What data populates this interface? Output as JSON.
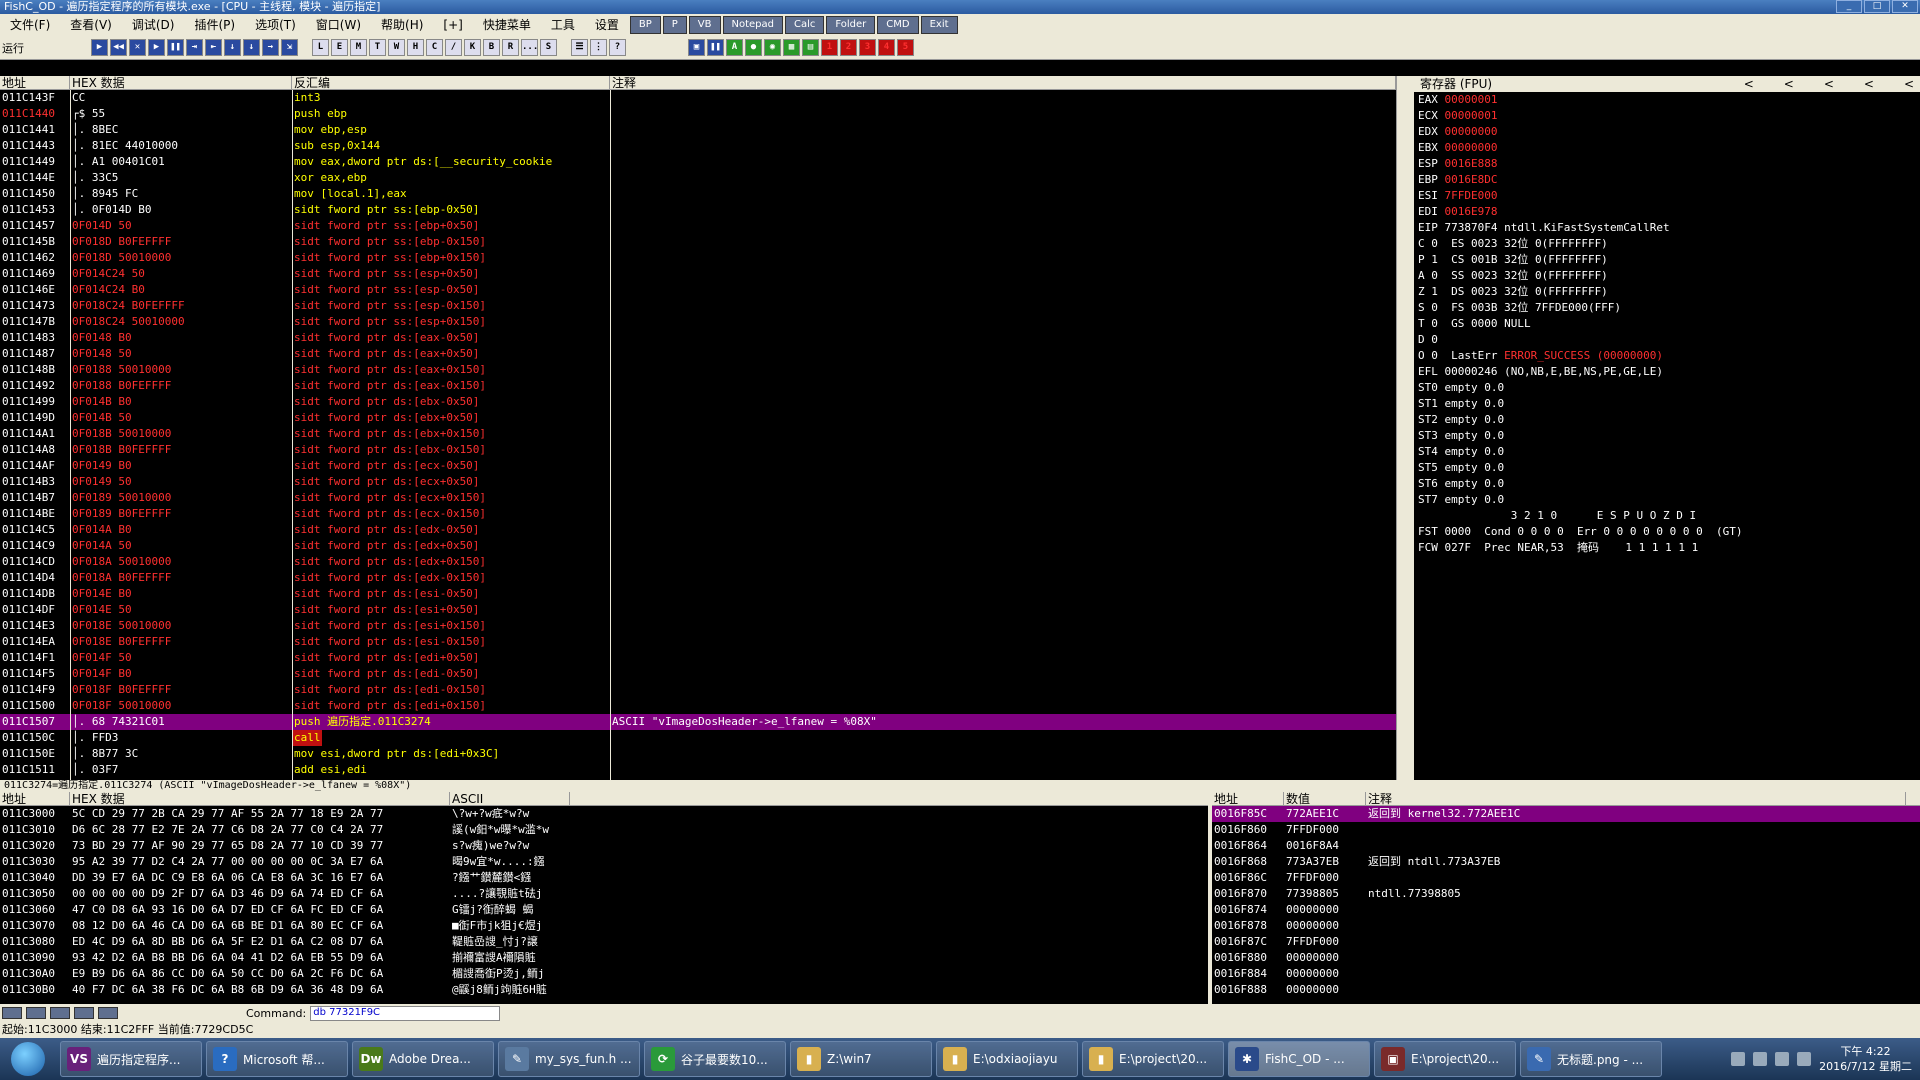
{
  "window": {
    "title": "FishC_OD - 遍历指定程序的所有模块.exe - [CPU - 主线程, 模块 - 遍历指定]"
  },
  "menu": {
    "items": [
      "文件(F)",
      "查看(V)",
      "调试(D)",
      "插件(P)",
      "选项(T)",
      "窗口(W)",
      "帮助(H)",
      "[+]",
      "快捷菜单",
      "工具",
      "设置"
    ],
    "quick": [
      "BP",
      "P",
      "VB",
      "Notepad",
      "Calc",
      "Folder",
      "CMD",
      "Exit"
    ]
  },
  "toolbar": {
    "state": "运行",
    "buttons": [
      "▶",
      "◀◀",
      "✕",
      "▶",
      "❚❚",
      "⇥",
      "⇤",
      "↓",
      "↓",
      "→",
      "⇲",
      "L",
      "E",
      "M",
      "T",
      "W",
      "H",
      "C",
      "/",
      "K",
      "B",
      "R",
      "...",
      "S",
      "☰",
      "⋮",
      "?"
    ],
    "right": [
      "▣",
      "❚❚",
      "A",
      "●",
      "◉",
      "▦",
      "▤",
      "1",
      "2",
      "3",
      "4",
      "5"
    ]
  },
  "cpu": {
    "headers": [
      "地址",
      "HEX 数据",
      "反汇编",
      "注释"
    ],
    "rows": [
      {
        "a": "011C143F",
        "h": "CC",
        "d": "int3",
        "c": "",
        "s": "n"
      },
      {
        "a": "011C1440",
        "h": "┌$ 55",
        "d": "push ebp",
        "c": "",
        "s": "ar"
      },
      {
        "a": "011C1441",
        "h": "│. 8BEC",
        "d": "mov ebp,esp",
        "c": "",
        "s": "n"
      },
      {
        "a": "011C1443",
        "h": "│. 81EC 44010000",
        "d": "sub esp,0x144",
        "c": "",
        "s": "n"
      },
      {
        "a": "011C1449",
        "h": "│. A1 00401C01",
        "d": "mov eax,dword ptr ds:[__security_cookie",
        "c": "",
        "s": "n"
      },
      {
        "a": "011C144E",
        "h": "│. 33C5",
        "d": "xor eax,ebp",
        "c": "",
        "s": "n"
      },
      {
        "a": "011C1450",
        "h": "│. 8945 FC",
        "d": "mov [local.1],eax",
        "c": "",
        "s": "n"
      },
      {
        "a": "011C1453",
        "h": "│. 0F014D B0",
        "d": "sidt fword ptr ss:[ebp-0x50]",
        "c": "",
        "s": "n"
      },
      {
        "a": "011C1457",
        "h": "  0F014D 50",
        "d": "sidt fword ptr ss:[ebp+0x50]",
        "c": "",
        "s": "r"
      },
      {
        "a": "011C145B",
        "h": "  0F018D B0FEFFFF",
        "d": "sidt fword ptr ss:[ebp-0x150]",
        "c": "",
        "s": "r"
      },
      {
        "a": "011C1462",
        "h": "  0F018D 50010000",
        "d": "sidt fword ptr ss:[ebp+0x150]",
        "c": "",
        "s": "r"
      },
      {
        "a": "011C1469",
        "h": "  0F014C24 50",
        "d": "sidt fword ptr ss:[esp+0x50]",
        "c": "",
        "s": "r"
      },
      {
        "a": "011C146E",
        "h": "  0F014C24 B0",
        "d": "sidt fword ptr ss:[esp-0x50]",
        "c": "",
        "s": "r"
      },
      {
        "a": "011C1473",
        "h": "  0F018C24 B0FEFFFF",
        "d": "sidt fword ptr ss:[esp-0x150]",
        "c": "",
        "s": "r"
      },
      {
        "a": "011C147B",
        "h": "  0F018C24 50010000",
        "d": "sidt fword ptr ss:[esp+0x150]",
        "c": "",
        "s": "r"
      },
      {
        "a": "011C1483",
        "h": "  0F0148 B0",
        "d": "sidt fword ptr ds:[eax-0x50]",
        "c": "",
        "s": "r"
      },
      {
        "a": "011C1487",
        "h": "  0F0148 50",
        "d": "sidt fword ptr ds:[eax+0x50]",
        "c": "",
        "s": "r"
      },
      {
        "a": "011C148B",
        "h": "  0F0188 50010000",
        "d": "sidt fword ptr ds:[eax+0x150]",
        "c": "",
        "s": "r"
      },
      {
        "a": "011C1492",
        "h": "  0F0188 B0FEFFFF",
        "d": "sidt fword ptr ds:[eax-0x150]",
        "c": "",
        "s": "r"
      },
      {
        "a": "011C1499",
        "h": "  0F014B B0",
        "d": "sidt fword ptr ds:[ebx-0x50]",
        "c": "",
        "s": "r"
      },
      {
        "a": "011C149D",
        "h": "  0F014B 50",
        "d": "sidt fword ptr ds:[ebx+0x50]",
        "c": "",
        "s": "r"
      },
      {
        "a": "011C14A1",
        "h": "  0F018B 50010000",
        "d": "sidt fword ptr ds:[ebx+0x150]",
        "c": "",
        "s": "r"
      },
      {
        "a": "011C14A8",
        "h": "  0F018B B0FEFFFF",
        "d": "sidt fword ptr ds:[ebx-0x150]",
        "c": "",
        "s": "r"
      },
      {
        "a": "011C14AF",
        "h": "  0F0149 B0",
        "d": "sidt fword ptr ds:[ecx-0x50]",
        "c": "",
        "s": "r"
      },
      {
        "a": "011C14B3",
        "h": "  0F0149 50",
        "d": "sidt fword ptr ds:[ecx+0x50]",
        "c": "",
        "s": "r"
      },
      {
        "a": "011C14B7",
        "h": "  0F0189 50010000",
        "d": "sidt fword ptr ds:[ecx+0x150]",
        "c": "",
        "s": "r"
      },
      {
        "a": "011C14BE",
        "h": "  0F0189 B0FEFFFF",
        "d": "sidt fword ptr ds:[ecx-0x150]",
        "c": "",
        "s": "r"
      },
      {
        "a": "011C14C5",
        "h": "  0F014A B0",
        "d": "sidt fword ptr ds:[edx-0x50]",
        "c": "",
        "s": "r"
      },
      {
        "a": "011C14C9",
        "h": "  0F014A 50",
        "d": "sidt fword ptr ds:[edx+0x50]",
        "c": "",
        "s": "r"
      },
      {
        "a": "011C14CD",
        "h": "  0F018A 50010000",
        "d": "sidt fword ptr ds:[edx+0x150]",
        "c": "",
        "s": "r"
      },
      {
        "a": "011C14D4",
        "h": "  0F018A B0FEFFFF",
        "d": "sidt fword ptr ds:[edx-0x150]",
        "c": "",
        "s": "r"
      },
      {
        "a": "011C14DB",
        "h": "  0F014E B0",
        "d": "sidt fword ptr ds:[esi-0x50]",
        "c": "",
        "s": "r"
      },
      {
        "a": "011C14DF",
        "h": "  0F014E 50",
        "d": "sidt fword ptr ds:[esi+0x50]",
        "c": "",
        "s": "r"
      },
      {
        "a": "011C14E3",
        "h": "  0F018E 50010000",
        "d": "sidt fword ptr ds:[esi+0x150]",
        "c": "",
        "s": "r"
      },
      {
        "a": "011C14EA",
        "h": "  0F018E B0FEFFFF",
        "d": "sidt fword ptr ds:[esi-0x150]",
        "c": "",
        "s": "r"
      },
      {
        "a": "011C14F1",
        "h": "  0F014F 50",
        "d": "sidt fword ptr ds:[edi+0x50]",
        "c": "",
        "s": "r"
      },
      {
        "a": "011C14F5",
        "h": "  0F014F B0",
        "d": "sidt fword ptr ds:[edi-0x50]",
        "c": "",
        "s": "r"
      },
      {
        "a": "011C14F9",
        "h": "  0F018F B0FEFFFF",
        "d": "sidt fword ptr ds:[edi-0x150]",
        "c": "",
        "s": "r"
      },
      {
        "a": "011C1500",
        "h": "  0F018F 50010000",
        "d": "sidt fword ptr ds:[edi+0x150]",
        "c": "",
        "s": "r"
      },
      {
        "a": "011C1507",
        "h": "│. 68 74321C01",
        "d": "push 遍历指定.011C3274",
        "c": "ASCII \"vImageDosHeader->e_lfanew = %08X\"",
        "s": "sel"
      },
      {
        "a": "011C150C",
        "h": "│. FFD3",
        "d": "call ebx",
        "c": "",
        "s": "call"
      },
      {
        "a": "011C150E",
        "h": "│. 8B77 3C",
        "d": "mov esi,dword ptr ds:[edi+0x3C]",
        "c": "",
        "s": "n"
      },
      {
        "a": "011C1511",
        "h": "│. 03F7",
        "d": "add esi,edi",
        "c": "",
        "s": "n"
      }
    ],
    "info": "011C3274=遍历指定.011C3274 (ASCII \"vImageDosHeader->e_lfanew = %08X\")"
  },
  "regs": {
    "title": "寄存器 (FPU)",
    "gpr": [
      [
        "EAX",
        "00000001"
      ],
      [
        "ECX",
        "00000001"
      ],
      [
        "EDX",
        "00000000"
      ],
      [
        "EBX",
        "00000000"
      ],
      [
        "ESP",
        "0016E888"
      ],
      [
        "EBP",
        "0016E8DC"
      ],
      [
        "ESI",
        "7FFDE000"
      ],
      [
        "EDI",
        "0016E978"
      ]
    ],
    "eip": "EIP 773870F4 ntdll.KiFastSystemCallRet",
    "flags": [
      "C 0  ES 0023 32位 0(FFFFFFFF)",
      "P 1  CS 001B 32位 0(FFFFFFFF)",
      "A 0  SS 0023 32位 0(FFFFFFFF)",
      "Z 1  DS 0023 32位 0(FFFFFFFF)",
      "S 0  FS 003B 32位 7FFDE000(FFF)",
      "T 0  GS 0000 NULL",
      "D 0"
    ],
    "lasterr": "O 0  LastErr ",
    "lasterr_val": "ERROR_SUCCESS (00000000)",
    "efl": "EFL 00000246 (NO,NB,E,BE,NS,PE,GE,LE)",
    "st": [
      "ST0 empty 0.0",
      "ST1 empty 0.0",
      "ST2 empty 0.0",
      "ST3 empty 0.0",
      "ST4 empty 0.0",
      "ST5 empty 0.0",
      "ST6 empty 0.0",
      "ST7 empty 0.0"
    ],
    "fpu": [
      "              3 2 1 0      E S P U O Z D I",
      "FST 0000  Cond 0 0 0 0  Err 0 0 0 0 0 0 0 0  (GT)",
      "FCW 027F  Prec NEAR,53  掩码    1 1 1 1 1 1"
    ]
  },
  "dump": {
    "headers": [
      "地址",
      "HEX 数据",
      "ASCII"
    ],
    "rows": [
      [
        "011C3000",
        "5C CD 29 77 2B CA 29 77 AF 55 2A 77 18 E9 2A 77",
        "\\?w+?w疷*w?w"
      ],
      [
        "011C3010",
        "D6 6C 28 77 E2 7E 2A 77 C6 D8 2A 77 C0 C4 2A 77",
        "謑(w鈤*w曝*w滥*w"
      ],
      [
        "011C3020",
        "73 BD 29 77 AF 90 29 77 65 D8 2A 77 10 CD 39 77",
        "s?w瘣)we?w?w"
      ],
      [
        "011C3030",
        "95 A2 39 77 D2 C4 2A 77 00 00 00 00 0C 3A E7 6A",
        "暍9w宜*w....:鏹"
      ],
      [
        "011C3040",
        "DD 39 E7 6A DC C9 E8 6A 06 CA E8 6A 3C 16 E7 6A",
        "?鏹艹鑚麓鑚<鏹"
      ],
      [
        "011C3050",
        "00 00 00 00 D9 2F D7 6A D3 46 D9 6A 74 ED CF 6A",
        "....?讓覨賘t砝j"
      ],
      [
        "011C3060",
        "47 C0 D8 6A 93 16 D0 6A D7 ED CF 6A FC ED CF 6A",
        "G镭j?衘醉蝎 蝎"
      ],
      [
        "011C3070",
        "08 12 D0 6A 46 CA D0 6A 6B BE D1 6A 80 EC CF 6A",
        "■衘F市jk狙j€煜j"
      ],
      [
        "011C3080",
        "ED 4C D9 6A 8D BB D6 6A 5F E2 D1 6A C2 08 D7 6A",
        "鞮賘嵒謏_忖j?譲"
      ],
      [
        "011C3090",
        "93 42 D2 6A B8 BB D6 6A 04 41 D2 6A EB 55 D9 6A",
        "揃襧富謏A襧隕賘"
      ],
      [
        "011C30A0",
        "E9 B9 D6 6A 86 CC D0 6A 50 CC D0 6A 2C F6 DC 6A",
        "楣謏喬衘P烫j,鲕j"
      ],
      [
        "011C30B0",
        "40 F7 DC 6A 38 F6 DC 6A B8 6B D9 6A 36 48 D9 6A",
        "@鼷j8鲕j竘賘6H賘"
      ]
    ]
  },
  "stack": {
    "headers": [
      "地址",
      "数值",
      "注释"
    ],
    "rows": [
      [
        "0016F85C",
        "772AEE1C",
        "返回到 kernel32.772AEE1C"
      ],
      [
        "0016F860",
        "7FFDF000",
        ""
      ],
      [
        "0016F864",
        "0016F8A4",
        ""
      ],
      [
        "0016F868",
        "773A37EB",
        "返回到 ntdll.773A37EB"
      ],
      [
        "0016F86C",
        "7FFDF000",
        ""
      ],
      [
        "0016F870",
        "77398805",
        "ntdll.77398805"
      ],
      [
        "0016F874",
        "00000000",
        ""
      ],
      [
        "0016F878",
        "00000000",
        ""
      ],
      [
        "0016F87C",
        "7FFDF000",
        ""
      ],
      [
        "0016F880",
        "00000000",
        ""
      ],
      [
        "0016F884",
        "00000000",
        ""
      ],
      [
        "0016F888",
        "00000000",
        ""
      ]
    ]
  },
  "split_info": "011C3274=遍历指定.011C3274 (ASCII \"vImageDosHeader->e_lfanew = %08X\")",
  "status": {
    "cmd_label": "Command:",
    "cmd_value": "db 77321F9C",
    "line2": "起始:11C3000 结束:11C2FFF 当前值:7729CD5C"
  },
  "taskbar": {
    "tasks": [
      {
        "label": "遍历指定程序...",
        "icon": "VS",
        "color": "#68217a"
      },
      {
        "label": "Microsoft 帮...",
        "icon": "?",
        "color": "#2a6cc0"
      },
      {
        "label": "Adobe Drea...",
        "icon": "Dw",
        "color": "#4a7a1a"
      },
      {
        "label": "my_sys_fun.h ...",
        "icon": "✎",
        "color": "#5a7aa0"
      },
      {
        "label": "谷子最要数10...",
        "icon": "⟳",
        "color": "#2a9a3a"
      },
      {
        "label": "Z:\\win7",
        "icon": "▮",
        "color": "#d8b050"
      },
      {
        "label": "E:\\odxiaojiayu",
        "icon": "▮",
        "color": "#d8b050"
      },
      {
        "label": "E:\\project\\20...",
        "icon": "▮",
        "color": "#d8b050"
      },
      {
        "label": "FishC_OD - ...",
        "icon": "✱",
        "color": "#2a4a8a"
      },
      {
        "label": "E:\\project\\20...",
        "icon": "▣",
        "color": "#7a2a2a"
      },
      {
        "label": "无标题.png - ...",
        "icon": "✎",
        "color": "#3a6ab0"
      }
    ],
    "time": "下午 4:22",
    "date": "2016/7/12 星期二"
  }
}
